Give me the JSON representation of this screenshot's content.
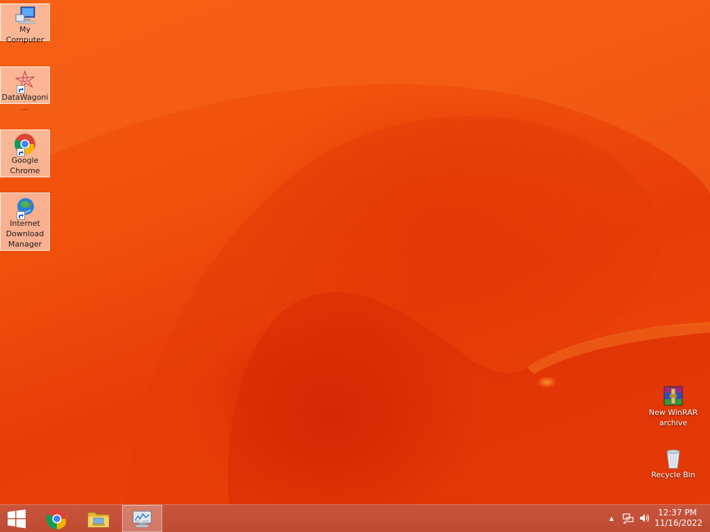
{
  "desktop": {
    "icons_left": [
      {
        "label": "My Computer",
        "icon": "computer-icon"
      },
      {
        "label": "DataWagoni...",
        "icon": "datawagon-icon"
      },
      {
        "label": "Google Chrome",
        "icon": "chrome-icon"
      },
      {
        "label": "Internet Download Manager",
        "icon": "idm-icon"
      }
    ],
    "icons_right": [
      {
        "label": "New WinRAR archive",
        "icon": "winrar-icon"
      },
      {
        "label": "Recycle Bin",
        "icon": "recycle-bin-icon"
      }
    ]
  },
  "taskbar": {
    "start": {
      "icon": "windows-start-icon"
    },
    "pinned": [
      {
        "name": "Google Chrome",
        "icon": "chrome-icon"
      },
      {
        "name": "File Explorer",
        "icon": "folder-icon"
      },
      {
        "name": "Monitor app",
        "icon": "monitor-chart-icon",
        "active": true
      }
    ],
    "tray": {
      "show_hidden": "▲",
      "network_icon": "network-icon",
      "volume_icon": "speaker-icon"
    },
    "clock": {
      "time": "12:37 PM",
      "date": "11/16/2022"
    }
  },
  "colors": {
    "wallpaper_base": "#f04a0a",
    "taskbar": "#c4503a",
    "selection": "#ffffff"
  }
}
